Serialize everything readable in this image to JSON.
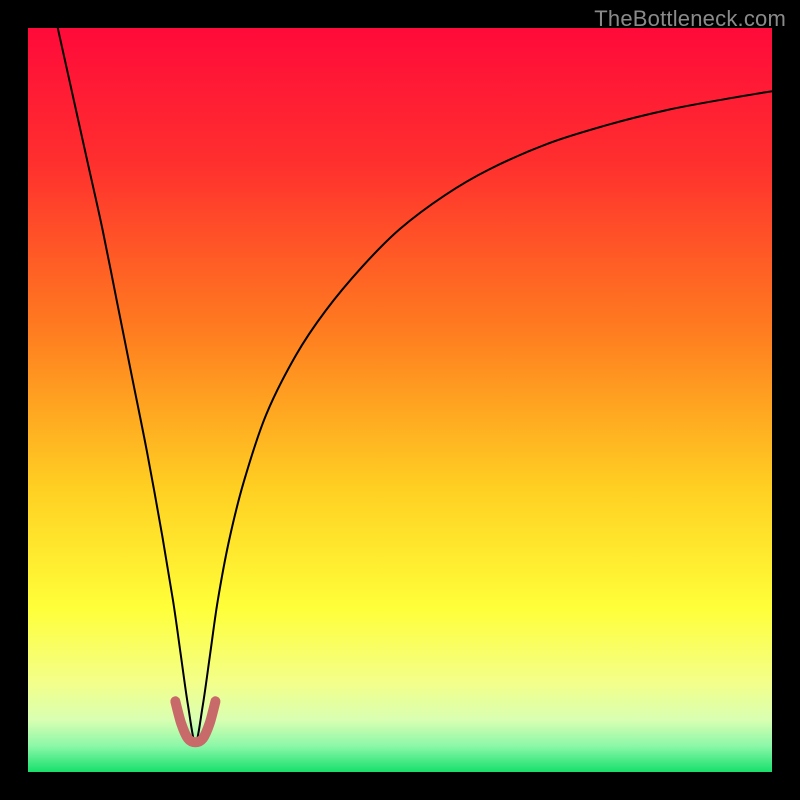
{
  "watermark": "TheBottleneck.com",
  "chart_data": {
    "type": "line",
    "title": "",
    "xlabel": "",
    "ylabel": "",
    "xlim": [
      0,
      100
    ],
    "ylim": [
      0,
      100
    ],
    "background_gradient": [
      {
        "pos": 0.0,
        "color": "#ff0a3a"
      },
      {
        "pos": 0.18,
        "color": "#ff2f2e"
      },
      {
        "pos": 0.4,
        "color": "#ff7a20"
      },
      {
        "pos": 0.62,
        "color": "#ffd022"
      },
      {
        "pos": 0.78,
        "color": "#ffff39"
      },
      {
        "pos": 0.88,
        "color": "#f3ff8a"
      },
      {
        "pos": 0.93,
        "color": "#d9ffb2"
      },
      {
        "pos": 0.965,
        "color": "#8cf7a8"
      },
      {
        "pos": 1.0,
        "color": "#17e06c"
      }
    ],
    "minimum": {
      "x": 22.5,
      "y": 4
    },
    "series": [
      {
        "name": "bottleneck-curve",
        "stroke": "#000000",
        "stroke_width": 2,
        "x": [
          4,
          6,
          8,
          10,
          12,
          14,
          16,
          18,
          19.5,
          20.5,
          21.5,
          22.5,
          23.5,
          24.5,
          25.5,
          27,
          29,
          32,
          36,
          40,
          45,
          50,
          56,
          62,
          70,
          78,
          86,
          94,
          100
        ],
        "y": [
          100,
          91,
          82,
          73,
          63,
          53,
          43,
          32,
          23,
          16,
          9,
          4,
          9,
          16,
          23,
          31,
          39,
          48,
          56,
          62,
          68,
          73,
          77.5,
          81,
          84.5,
          87,
          89,
          90.5,
          91.5
        ]
      },
      {
        "name": "highlight-band",
        "stroke": "#c96a6a",
        "stroke_width": 10,
        "linecap": "round",
        "x": [
          19.8,
          20.6,
          21.5,
          22.5,
          23.5,
          24.4,
          25.2
        ],
        "y": [
          9.5,
          6.5,
          4.5,
          4.0,
          4.5,
          6.5,
          9.5
        ]
      }
    ]
  }
}
